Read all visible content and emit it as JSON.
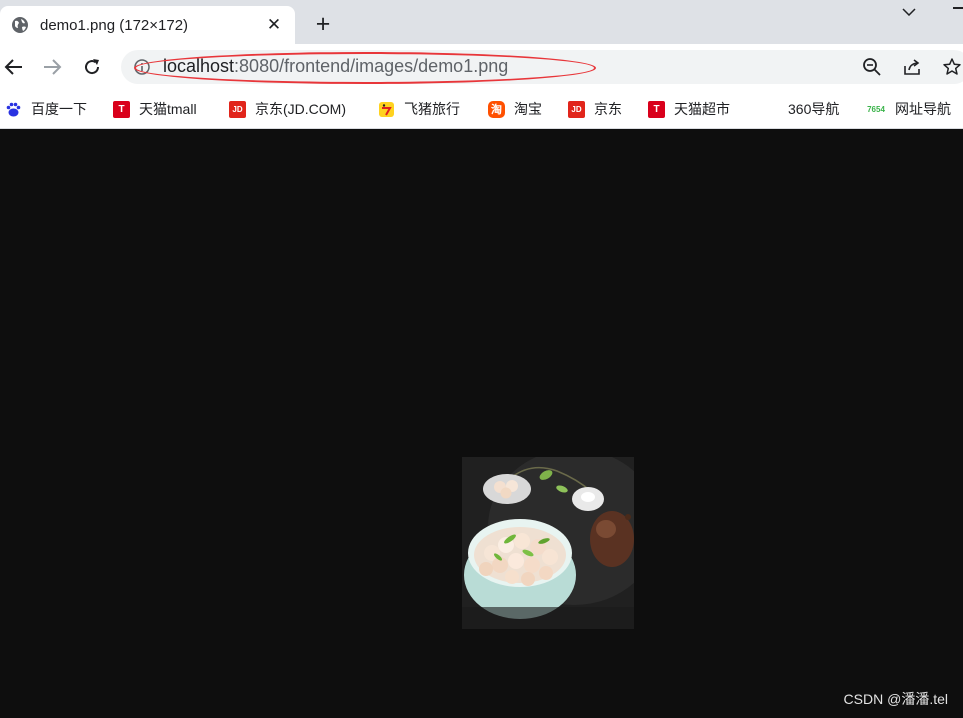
{
  "tab": {
    "title": "demo1.png (172×172)"
  },
  "address_bar": {
    "host": "localhost",
    "path": ":8080/frontend/images/demo1.png"
  },
  "bookmarks": [
    {
      "label": "百度一下",
      "icon": "baidu-icon"
    },
    {
      "label": "天猫tmall",
      "icon": "tmall-icon"
    },
    {
      "label": "京东(JD.COM)",
      "icon": "jd-icon"
    },
    {
      "label": "飞猪旅行",
      "icon": "fliggy-icon"
    },
    {
      "label": "淘宝",
      "icon": "taobao-icon"
    },
    {
      "label": "京东",
      "icon": "jd-icon"
    },
    {
      "label": "天猫超市",
      "icon": "tmall-icon"
    },
    {
      "label": "360导航",
      "icon": ""
    },
    {
      "label": "网址导航",
      "icon": "site-nav-icon"
    }
  ],
  "icon_glyphs": {
    "tmall": "T",
    "jd": "JD",
    "taobao": "淘",
    "site_nav": "7654"
  },
  "watermark": "CSDN @潘潘.tel",
  "colors": {
    "annotation": "#e8363a",
    "background": "#0e0e0e",
    "tmall": "#d9001b",
    "jd": "#e1251b",
    "taobao": "#ff5000",
    "baidu": "#2932e1"
  }
}
